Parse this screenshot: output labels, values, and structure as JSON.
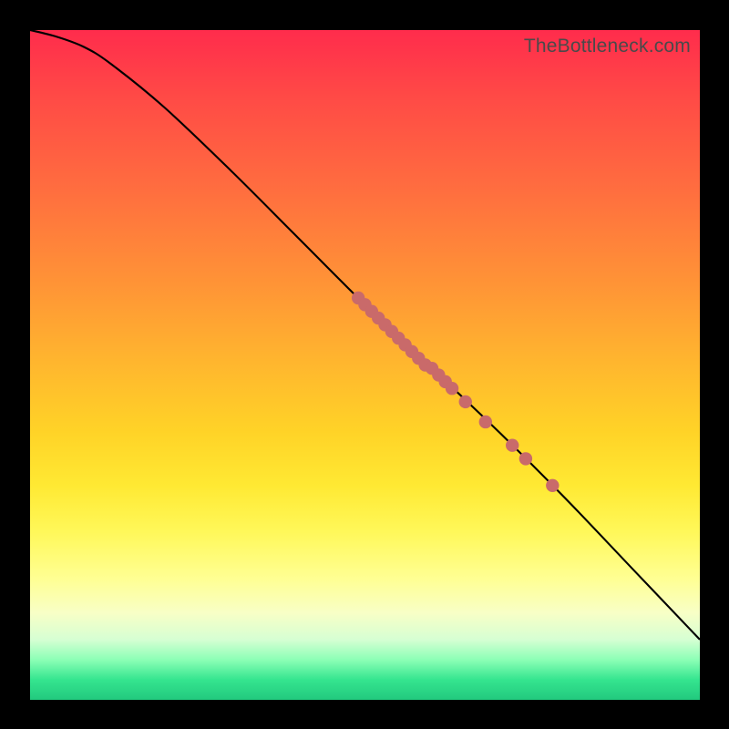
{
  "watermark": "TheBottleneck.com",
  "chart_data": {
    "type": "line",
    "title": "",
    "xlabel": "",
    "ylabel": "",
    "xlim": [
      0,
      100
    ],
    "ylim": [
      0,
      100
    ],
    "curve": {
      "name": "bottleneck-curve",
      "x": [
        0,
        4,
        8,
        12,
        20,
        30,
        40,
        50,
        60,
        70,
        80,
        90,
        100
      ],
      "y": [
        100,
        99,
        97.5,
        95,
        88.5,
        79,
        69,
        59,
        49.5,
        40,
        30,
        19.5,
        9
      ]
    },
    "markers": {
      "name": "sample-points",
      "points": [
        {
          "x": 49,
          "y": 60.0
        },
        {
          "x": 50,
          "y": 59.0
        },
        {
          "x": 51,
          "y": 58.0
        },
        {
          "x": 52,
          "y": 57.0
        },
        {
          "x": 53,
          "y": 56.0
        },
        {
          "x": 54,
          "y": 55.0
        },
        {
          "x": 55,
          "y": 54.0
        },
        {
          "x": 56,
          "y": 53.0
        },
        {
          "x": 57,
          "y": 52.0
        },
        {
          "x": 58,
          "y": 51.0
        },
        {
          "x": 59,
          "y": 50.0
        },
        {
          "x": 60,
          "y": 49.5
        },
        {
          "x": 61,
          "y": 48.5
        },
        {
          "x": 62,
          "y": 47.5
        },
        {
          "x": 63,
          "y": 46.5
        },
        {
          "x": 65,
          "y": 44.5
        },
        {
          "x": 68,
          "y": 41.5
        },
        {
          "x": 72,
          "y": 38.0
        },
        {
          "x": 74,
          "y": 36.0
        },
        {
          "x": 78,
          "y": 32.0
        }
      ]
    },
    "gradient_stops": [
      {
        "pos": 0,
        "color": "#ff2c4c"
      },
      {
        "pos": 10,
        "color": "#ff4a46"
      },
      {
        "pos": 24,
        "color": "#ff6e3f"
      },
      {
        "pos": 38,
        "color": "#ff9436"
      },
      {
        "pos": 50,
        "color": "#ffb72e"
      },
      {
        "pos": 60,
        "color": "#ffd327"
      },
      {
        "pos": 68,
        "color": "#ffe933"
      },
      {
        "pos": 75,
        "color": "#fff85a"
      },
      {
        "pos": 82,
        "color": "#ffff94"
      },
      {
        "pos": 87,
        "color": "#f8ffc6"
      },
      {
        "pos": 91,
        "color": "#d6ffd3"
      },
      {
        "pos": 94,
        "color": "#8cffb6"
      },
      {
        "pos": 97,
        "color": "#35e58f"
      },
      {
        "pos": 100,
        "color": "#22c97e"
      }
    ]
  }
}
